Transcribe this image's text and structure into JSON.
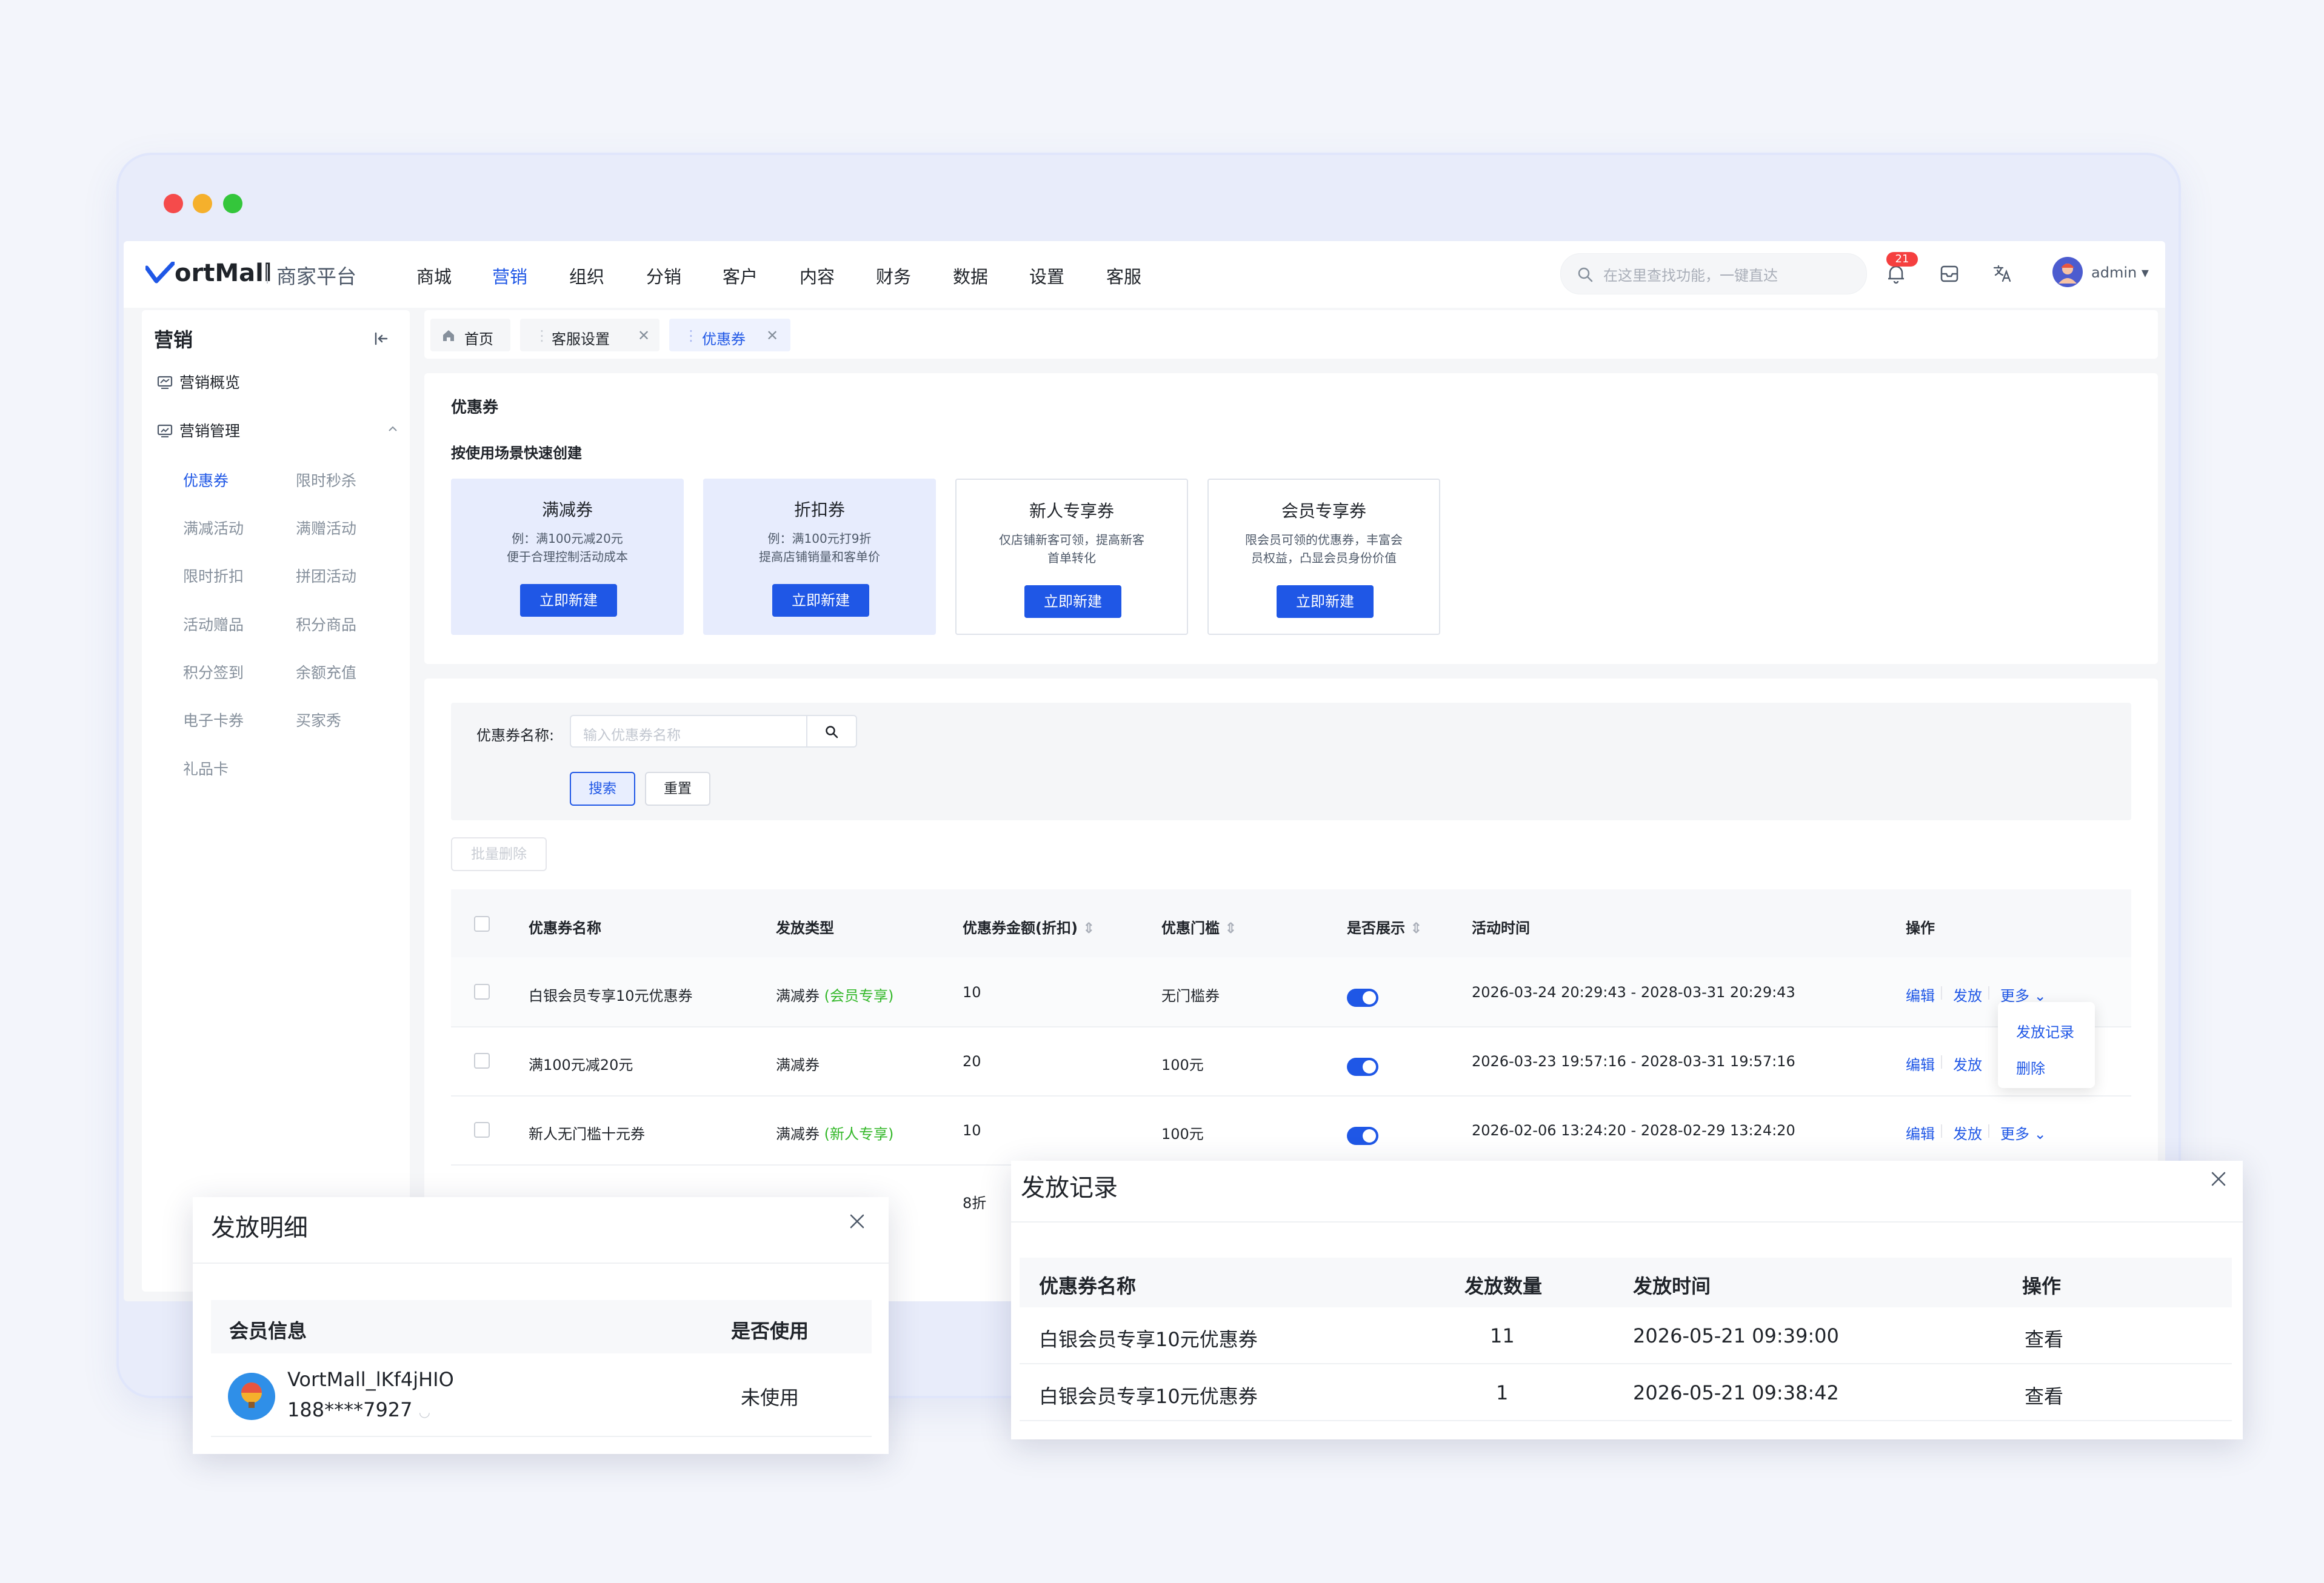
{
  "window": {
    "dots": [
      "#f54b4b",
      "#f5b02c",
      "#34c63b"
    ]
  },
  "header": {
    "logo_main": "ortMall",
    "logo_sub": "商家平台",
    "nav": [
      "商城",
      "营销",
      "组织",
      "分销",
      "客户",
      "内容",
      "财务",
      "数据",
      "设置",
      "客服"
    ],
    "active_nav": "营销",
    "search_placeholder": "在这里查找功能，一键直达",
    "notification_count": "21",
    "user": "admin"
  },
  "sidebar": {
    "title": "营销",
    "overview": "营销概览",
    "group": "营销管理",
    "items": [
      "优惠券",
      "限时秒杀",
      "满减活动",
      "满赠活动",
      "限时折扣",
      "拼团活动",
      "活动赠品",
      "积分商品",
      "积分签到",
      "余额充值",
      "电子卡券",
      "买家秀",
      "礼品卡"
    ],
    "active_item": "优惠券"
  },
  "tabs": [
    "首页",
    "客服设置",
    "优惠券"
  ],
  "create_panel": {
    "title": "优惠券",
    "subtitle": "按使用场景快速创建",
    "cards": [
      {
        "title": "满减券",
        "desc1": "例：满100元减20元",
        "desc2": "便于合理控制活动成本",
        "button": "立即新建"
      },
      {
        "title": "折扣券",
        "desc1": "例：满100元打9折",
        "desc2": "提高店铺销量和客单价",
        "button": "立即新建"
      },
      {
        "title": "新人专享券",
        "desc1": "仅店铺新客可领，提高新客",
        "desc2": "首单转化",
        "button": "立即新建"
      },
      {
        "title": "会员专享券",
        "desc1": "限会员可领的优惠券，丰富会",
        "desc2": "员权益，凸显会员身份价值",
        "button": "立即新建"
      }
    ]
  },
  "filter": {
    "label": "优惠券名称:",
    "placeholder": "输入优惠券名称",
    "search": "搜索",
    "reset": "重置",
    "batch_delete": "批量删除"
  },
  "table": {
    "headers": [
      "优惠券名称",
      "发放类型",
      "优惠券金额(折扣)",
      "优惠门槛",
      "是否展示",
      "活动时间",
      "操作"
    ],
    "rows": [
      {
        "name": "白银会员专享10元优惠券",
        "type": "满减券",
        "tag": "(会员专享)",
        "amount": "10",
        "threshold": "无门槛券",
        "time": "2026-03-24 20:29:43 - 2028-03-31 20:29:43"
      },
      {
        "name": "满100元减20元",
        "type": "满减券",
        "tag": "",
        "amount": "20",
        "threshold": "100元",
        "time": "2026-03-23 19:57:16 - 2028-03-31 19:57:16"
      },
      {
        "name": "新人无门槛十元券",
        "type": "满减券",
        "tag": "(新人专享)",
        "amount": "10",
        "threshold": "100元",
        "time": "2026-02-06 13:24:20 - 2028-02-29 13:24:20"
      },
      {
        "name": "",
        "type": "",
        "tag": "",
        "amount": "8折",
        "threshold": "",
        "time": ""
      }
    ],
    "actions": {
      "edit": "编辑",
      "issue": "发放",
      "more": "更多"
    },
    "more_menu": [
      "发放记录",
      "删除"
    ]
  },
  "modal_detail": {
    "title": "发放明细",
    "headers": [
      "会员信息",
      "是否使用"
    ],
    "member_name": "VortMall_lKf4jHIO",
    "member_phone": "188****7927",
    "used": "未使用"
  },
  "modal_record": {
    "title": "发放记录",
    "headers": [
      "优惠券名称",
      "发放数量",
      "发放时间",
      "操作"
    ],
    "rows": [
      {
        "name": "白银会员专享10元优惠券",
        "count": "11",
        "time": "2026-05-21 09:39:00",
        "action": "查看"
      },
      {
        "name": "白银会员专享10元优惠券",
        "count": "1",
        "time": "2026-05-21 09:38:42",
        "action": "查看"
      }
    ]
  }
}
